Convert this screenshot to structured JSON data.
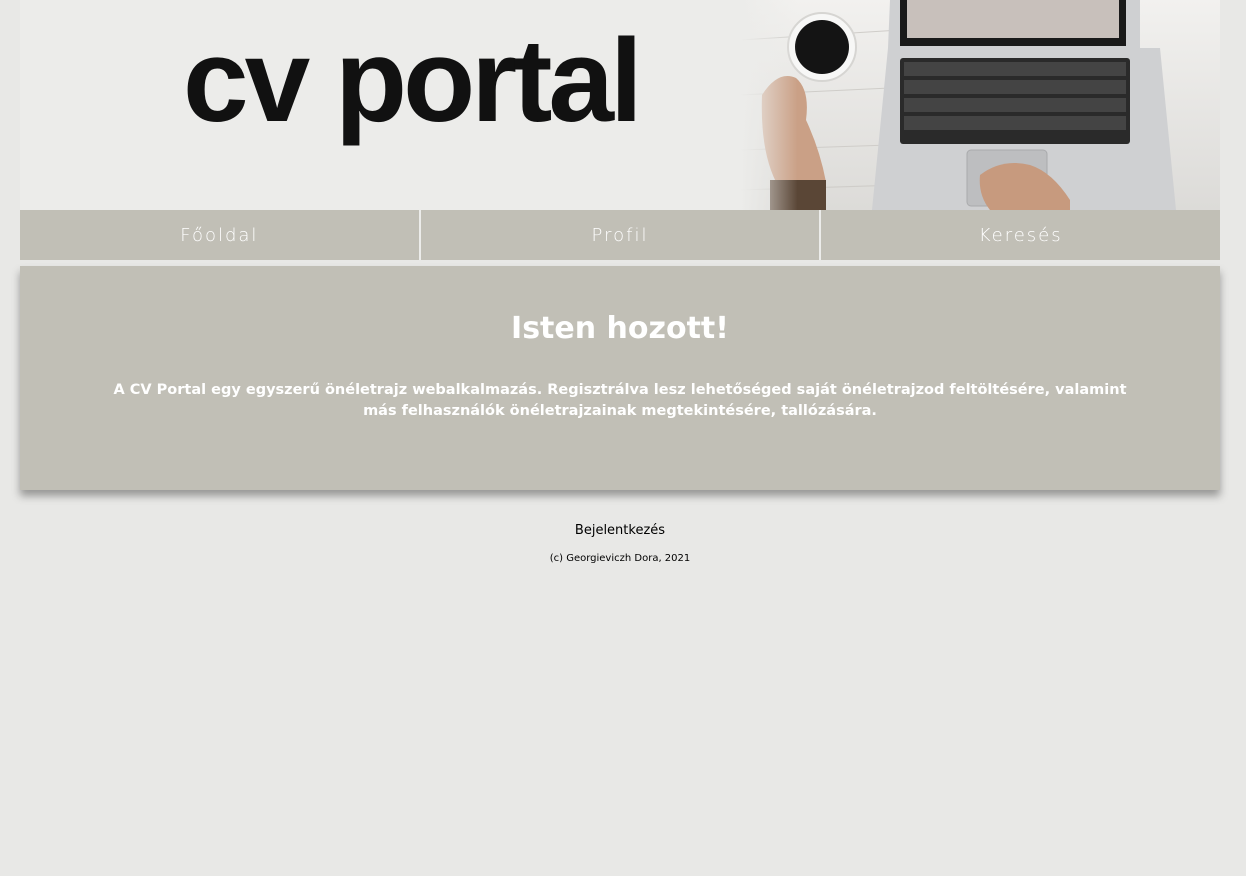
{
  "header": {
    "logo_text": "cv portal",
    "photo_icon": "laptop-coffee-photo"
  },
  "nav": {
    "items": [
      {
        "label": "Főoldal"
      },
      {
        "label": "Profil"
      },
      {
        "label": "Keresés"
      }
    ]
  },
  "welcome": {
    "title": "Isten hozott!",
    "text": "A CV Portal egy egyszerű önéletrajz webalkalmazás. Regisztrálva lesz lehetőséged saját önéletrajzod feltöltésére, valamint más felhasználók önéletrajzainak megtekintésére, tallózására."
  },
  "footer": {
    "login_label": "Bejelentkezés",
    "copyright": "(c) Georgieviczh Dora, 2021"
  },
  "colors": {
    "page_background": "#e8e8e6",
    "accent": "#c1bfb6",
    "text_light": "#ffffff",
    "text_dark": "#000000"
  }
}
